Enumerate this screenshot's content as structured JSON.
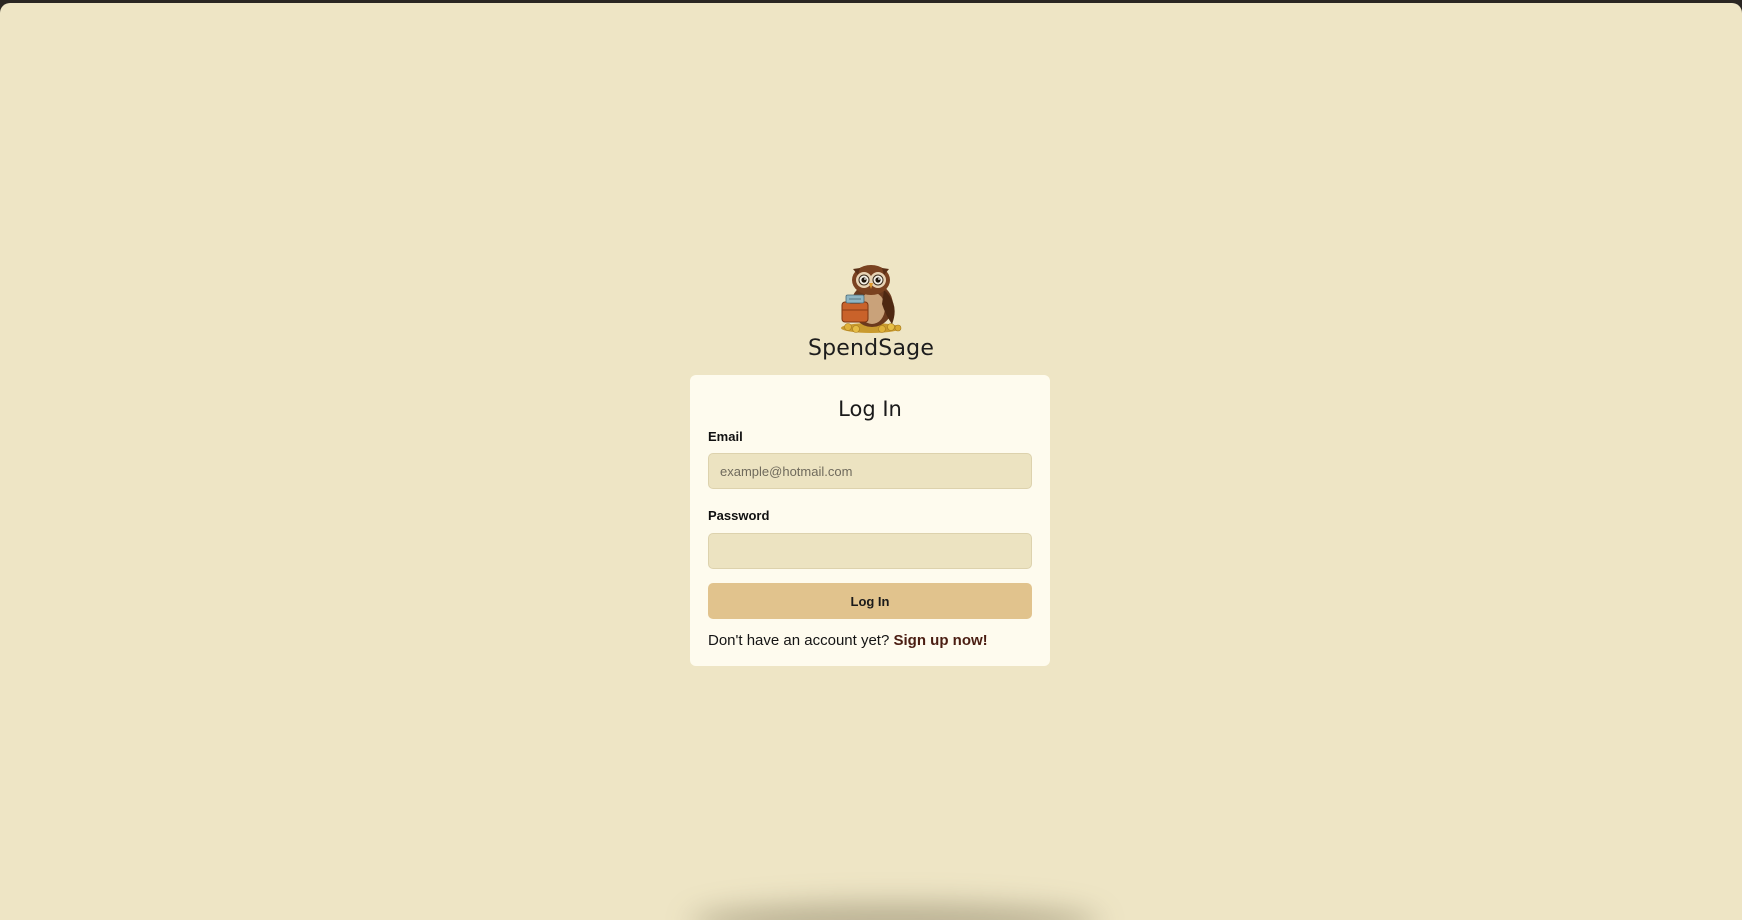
{
  "app": {
    "name": "SpendSage",
    "logo_icon": "owl-with-briefcase-icon"
  },
  "login_form": {
    "title": "Log In",
    "email": {
      "label": "Email",
      "value": "",
      "placeholder": "example@hotmail.com"
    },
    "password": {
      "label": "Password",
      "value": "",
      "placeholder": ""
    },
    "submit_label": "Log In",
    "signup_prompt": "Don't have an account yet?",
    "signup_link": "Sign up now!"
  },
  "colors": {
    "page_background": "#eee5c5",
    "card_background": "#fefbee",
    "input_background": "#ece3c1",
    "button_background": "#e1c38d",
    "link_color": "#4a1d12"
  }
}
